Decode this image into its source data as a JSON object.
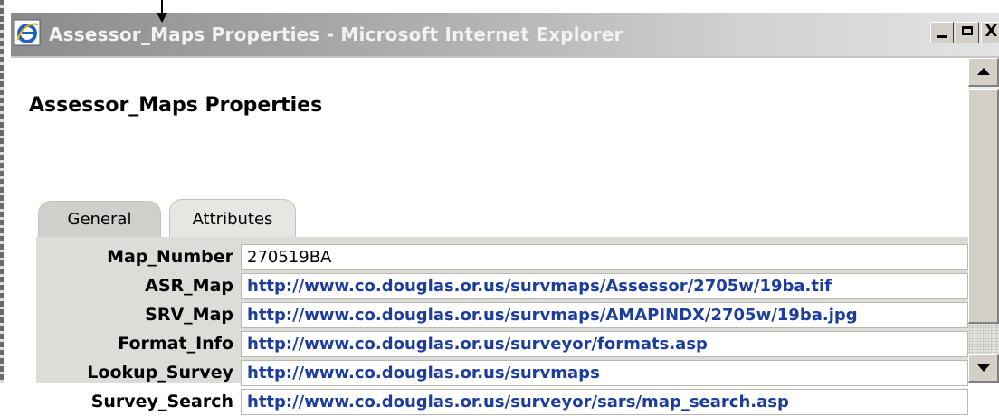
{
  "window": {
    "title": "Assessor_Maps Properties - Microsoft Internet Explorer",
    "icon": "internet-explorer-icon",
    "buttons": {
      "minimize": "minimize-icon",
      "maximize": "maximize-icon",
      "close": "X"
    }
  },
  "page": {
    "title": "Assessor_Maps Properties",
    "tabs": [
      {
        "label": "General",
        "selected": false
      },
      {
        "label": "Attributes",
        "selected": true
      }
    ]
  },
  "attributes": [
    {
      "label": "Map_Number",
      "value": "270519BA",
      "is_link": false
    },
    {
      "label": "ASR_Map",
      "value": "http://www.co.douglas.or.us/survmaps/Assessor/2705w/19ba.tif",
      "is_link": true
    },
    {
      "label": "SRV_Map",
      "value": "http://www.co.douglas.or.us/survmaps/AMAPINDX/2705w/19ba.jpg",
      "is_link": true
    },
    {
      "label": "Format_Info",
      "value": "http://www.co.douglas.or.us/surveyor/formats.asp",
      "is_link": true
    },
    {
      "label": "Lookup_Survey",
      "value": "http://www.co.douglas.or.us/survmaps",
      "is_link": true
    },
    {
      "label": "Survey_Search",
      "value": "http://www.co.douglas.or.us/surveyor/sars/map_search.asp",
      "is_link": true
    }
  ],
  "colors": {
    "link": "#1c3c9e",
    "panel": "#dcdcd8",
    "titlebar_start": "#8c8c8c",
    "titlebar_end": "#e3e3e3"
  }
}
